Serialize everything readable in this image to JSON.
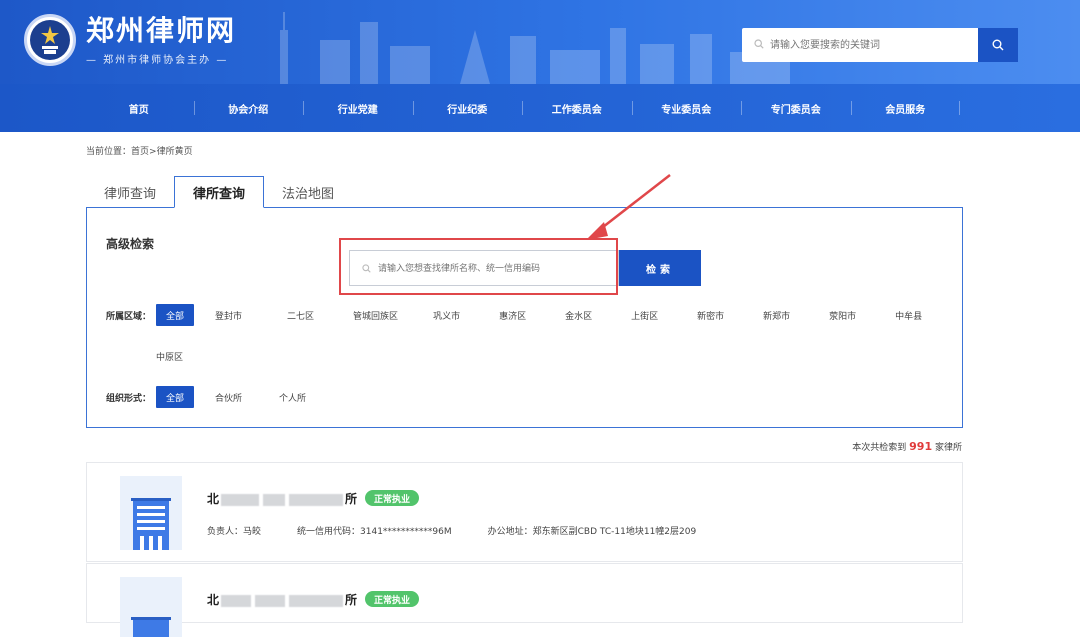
{
  "header": {
    "site_title": "郑州律师网",
    "site_subtitle": "— 郑州市律师协会主办 —",
    "search_placeholder": "请输入您要搜索的关键词"
  },
  "nav": [
    "首页",
    "协会介绍",
    "行业党建",
    "行业纪委",
    "工作委员会",
    "专业委员会",
    "专门委员会",
    "会员服务"
  ],
  "breadcrumb": {
    "prefix": "当前位置：",
    "home": "首页",
    "sep": ">",
    "current": "律所黄页"
  },
  "tabs": [
    {
      "label": "律师查询",
      "active": false
    },
    {
      "label": "律所查询",
      "active": true
    },
    {
      "label": "法治地图",
      "active": false
    }
  ],
  "search_panel": {
    "title": "高级检索",
    "placeholder": "请输入您想查找律所名称、统一信用编码",
    "button": "检索"
  },
  "filters": {
    "region_label": "所属区域：",
    "regions_row1": [
      "全部",
      "登封市",
      "二七区",
      "管城回族区",
      "巩义市",
      "惠济区",
      "金水区",
      "上街区",
      "新密市",
      "新郑市",
      "荥阳市",
      "中牟县"
    ],
    "regions_row2": [
      "中原区"
    ],
    "org_label": "组织形式：",
    "org_types": [
      "全部",
      "合伙所",
      "个人所"
    ]
  },
  "result_count": {
    "prefix": "本次共检索到",
    "count": "991",
    "suffix": "家律所"
  },
  "results": [
    {
      "name_start": "北",
      "name_end": "所",
      "status": "正常执业",
      "manager": "负责人：马皎",
      "credit_code": "统一信用代码：3141***********96M",
      "address": "办公地址：郑东新区副CBD TC-11地块11幢2层209"
    },
    {
      "name_start": "北",
      "name_end": "所",
      "status": "正常执业"
    }
  ],
  "colors": {
    "primary": "#1b53c4",
    "nav": "#2a6ee0",
    "highlight": "#e0474a",
    "status": "#52c46b",
    "count": "#e03a3a"
  }
}
